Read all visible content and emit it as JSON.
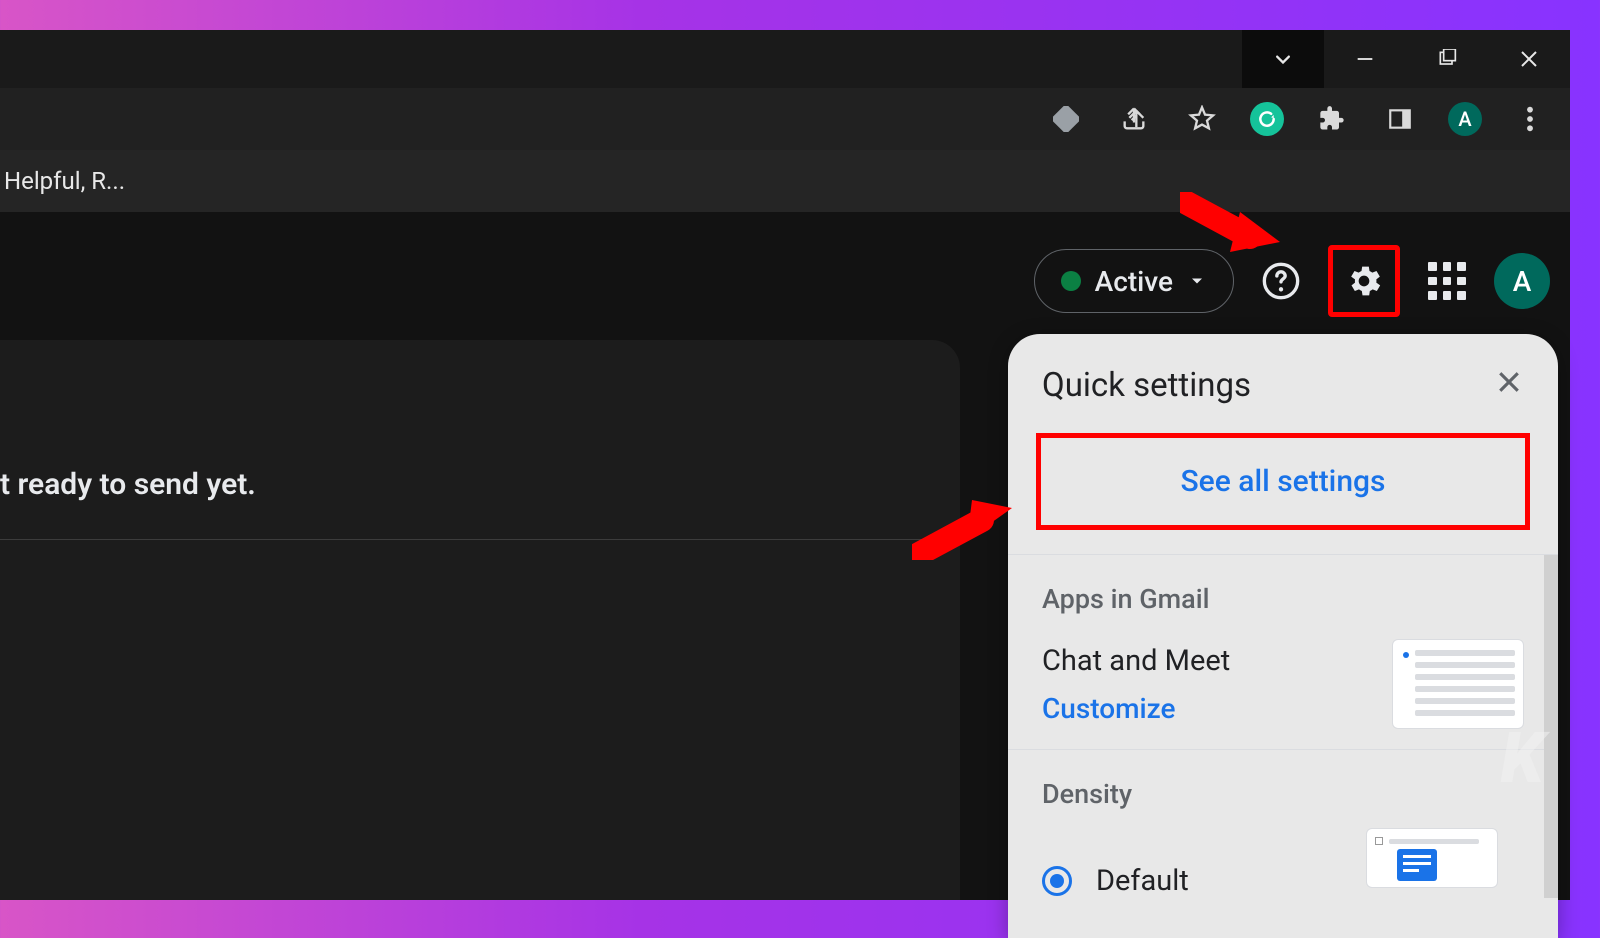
{
  "window": {
    "bookmark_truncated": "Helpful, R..."
  },
  "toolbar": {
    "profile_letter": "A"
  },
  "app": {
    "status_label": "Active",
    "avatar_letter": "A",
    "content_line": "t ready to send yet."
  },
  "quick_settings": {
    "title": "Quick settings",
    "see_all": "See all settings",
    "sections": {
      "apps_in_gmail": {
        "heading": "Apps in Gmail",
        "item_label": "Chat and Meet",
        "customize": "Customize"
      },
      "density": {
        "heading": "Density",
        "options": {
          "default": "Default"
        }
      }
    }
  },
  "watermark": "K"
}
